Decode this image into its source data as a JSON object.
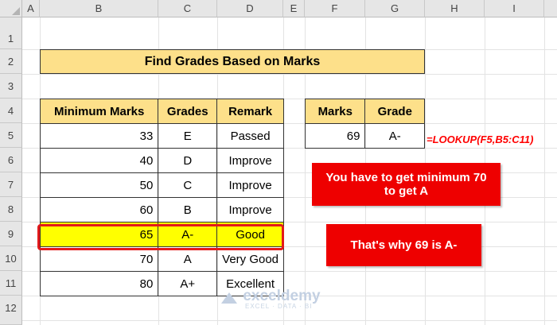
{
  "columns": [
    "A",
    "B",
    "C",
    "D",
    "E",
    "F",
    "G",
    "H",
    "I"
  ],
  "rows": [
    "1",
    "2",
    "3",
    "4",
    "5",
    "6",
    "7",
    "8",
    "9",
    "10",
    "11",
    "12"
  ],
  "title": "Find Grades Based on Marks",
  "table1": {
    "headers": [
      "Minimum Marks",
      "Grades",
      "Remark"
    ],
    "rows": [
      {
        "marks": "33",
        "grade": "E",
        "remark": "Passed"
      },
      {
        "marks": "40",
        "grade": "D",
        "remark": "Improve"
      },
      {
        "marks": "50",
        "grade": "C",
        "remark": "Improve"
      },
      {
        "marks": "60",
        "grade": "B",
        "remark": "Improve"
      },
      {
        "marks": "65",
        "grade": "A-",
        "remark": "Good"
      },
      {
        "marks": "70",
        "grade": "A",
        "remark": "Very Good"
      },
      {
        "marks": "80",
        "grade": "A+",
        "remark": "Excellent"
      }
    ],
    "highlight_color": "#ffff00",
    "header_color": "#fde08a"
  },
  "table2": {
    "headers": [
      "Marks",
      "Grade"
    ],
    "row": {
      "marks": "69",
      "grade": "A-"
    }
  },
  "formula": "=LOOKUP(F5,B5:C11)",
  "callout1": "You have to get minimum 70 to get A",
  "callout2": "That's why 69 is A-",
  "watermark": {
    "name": "exceldemy",
    "tagline": "EXCEL · DATA · BI"
  },
  "accent_red": "#ee0000"
}
